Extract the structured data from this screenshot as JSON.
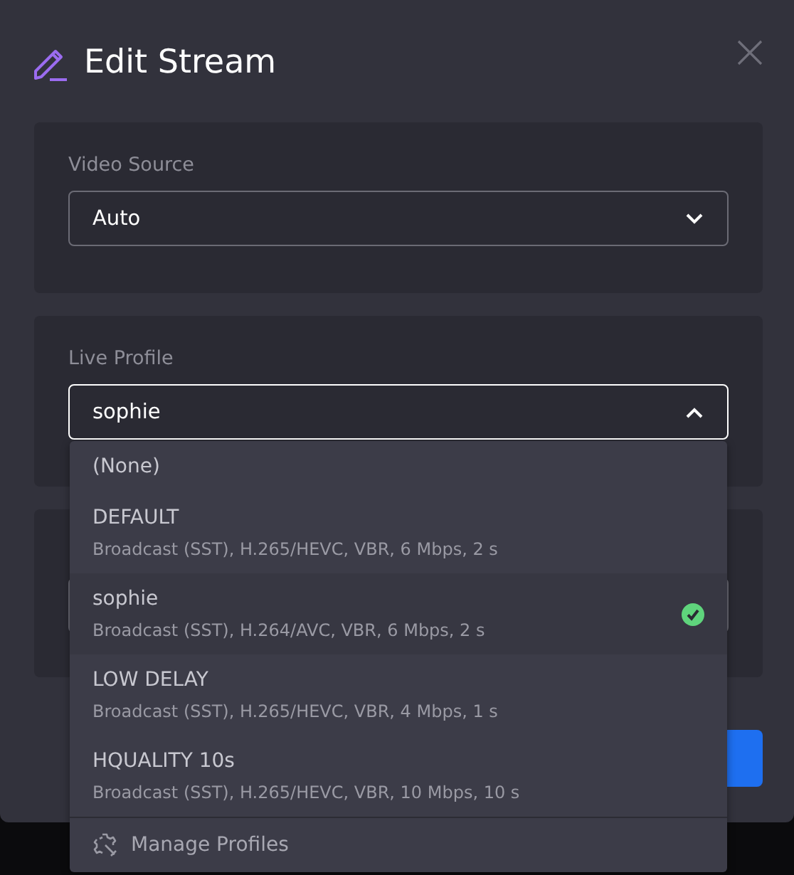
{
  "dialog": {
    "title": "Edit Stream"
  },
  "video_source": {
    "label": "Video Source",
    "value": "Auto",
    "expanded": false
  },
  "live_profile": {
    "label": "Live Profile",
    "value": "sophie",
    "expanded": true,
    "options": [
      {
        "title": "(None)",
        "selected": false
      },
      {
        "title": "DEFAULT",
        "detail": "Broadcast (SST), H.265/HEVC, VBR, 6 Mbps, 2 s",
        "selected": false
      },
      {
        "title": "sophie",
        "detail": "Broadcast (SST), H.264/AVC, VBR, 6 Mbps, 2 s",
        "selected": true
      },
      {
        "title": "LOW DELAY",
        "detail": "Broadcast (SST), H.265/HEVC, VBR, 4 Mbps, 1 s",
        "selected": false
      },
      {
        "title": "HQUALITY 10s",
        "detail": "Broadcast (SST), H.265/HEVC, VBR, 10 Mbps, 10 s",
        "selected": false
      }
    ],
    "manage_label": "Manage Profiles"
  }
}
